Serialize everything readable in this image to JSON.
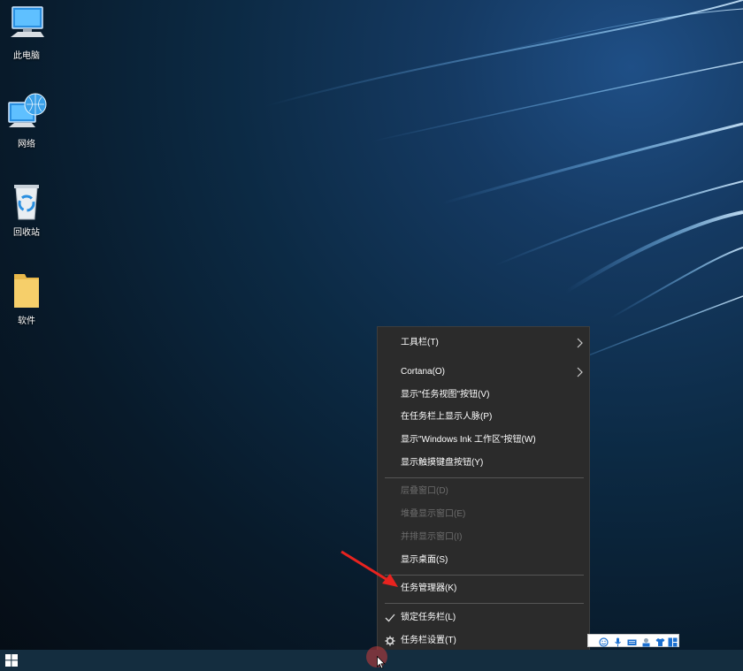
{
  "desktop": {
    "icons": [
      {
        "label": "此电脑",
        "icon": "computer-icon"
      },
      {
        "label": "网络",
        "icon": "network-icon"
      },
      {
        "label": "回收站",
        "icon": "recycle-bin-icon"
      },
      {
        "label": "软件",
        "icon": "folder-icon"
      }
    ]
  },
  "context_menu": {
    "items": [
      {
        "label": "工具栏(T)",
        "submenu": true,
        "enabled": true
      },
      {
        "label": "Cortana(O)",
        "submenu": true,
        "enabled": true
      },
      {
        "label": "显示\"任务视图\"按钮(V)",
        "enabled": true
      },
      {
        "label": "在任务栏上显示人脉(P)",
        "enabled": true
      },
      {
        "label": "显示\"Windows Ink 工作区\"按钮(W)",
        "enabled": true
      },
      {
        "label": "显示触摸键盘按钮(Y)",
        "enabled": true
      },
      {
        "label": "层叠窗口(D)",
        "enabled": false
      },
      {
        "label": "堆叠显示窗口(E)",
        "enabled": false
      },
      {
        "label": "并排显示窗口(I)",
        "enabled": false
      },
      {
        "label": "显示桌面(S)",
        "enabled": true
      },
      {
        "label": "任务管理器(K)",
        "enabled": true,
        "highlighted_by_arrow": true
      },
      {
        "label": "锁定任务栏(L)",
        "enabled": true,
        "checked": true
      },
      {
        "label": "任务栏设置(T)",
        "enabled": true,
        "icon": "gear-icon"
      }
    ]
  },
  "colors": {
    "menu_bg": "#2b2b2b",
    "annotation_arrow": "#e8231f",
    "taskbar": "#142d3f"
  },
  "taskbar": {
    "start_icon": "windows-logo-icon",
    "tray_icons": [
      "smiley-icon",
      "microphone-icon",
      "keyboard-icon",
      "settings-tool-icon",
      "shirt-icon",
      "grid-icon"
    ]
  }
}
